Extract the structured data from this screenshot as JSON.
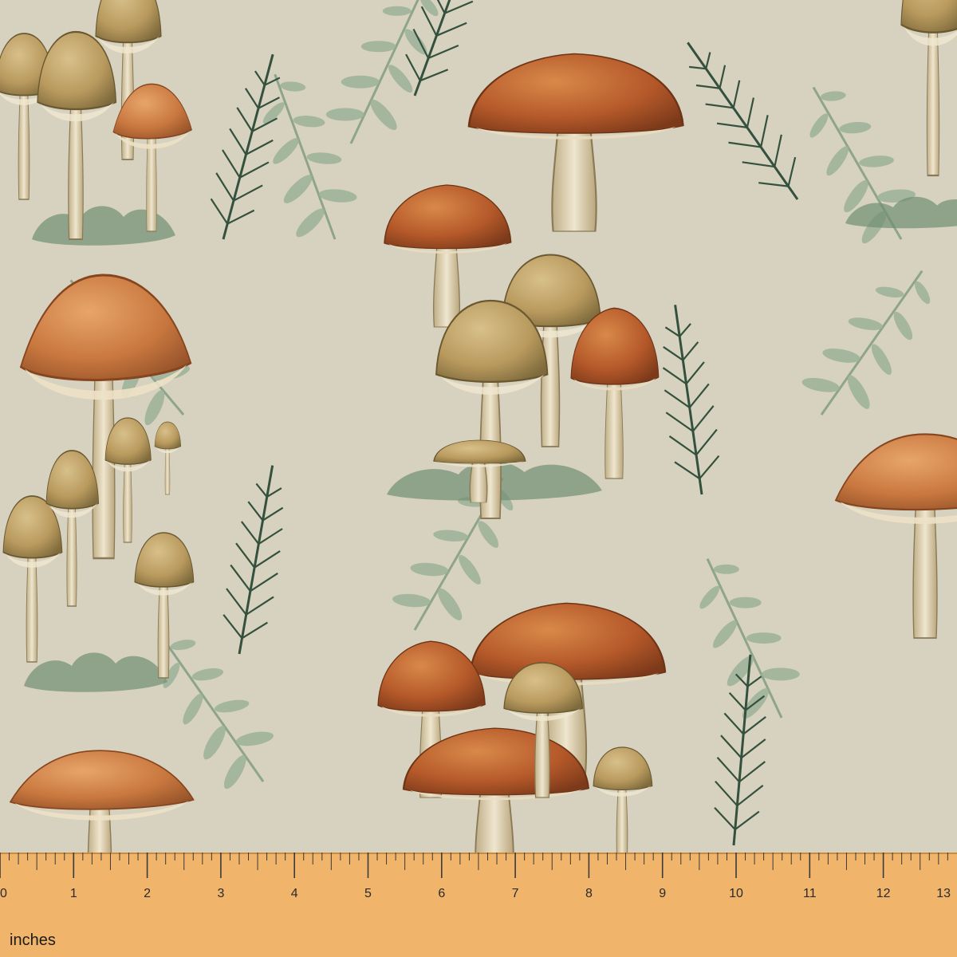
{
  "fabric": {
    "background_color": "#d6d2bf",
    "motifs": [
      "mushroom-cluster-icon",
      "fern-leaf-icon",
      "pine-sprig-icon"
    ],
    "colors": {
      "cap_rust": "#b5592a",
      "cap_orange": "#c9783f",
      "cap_tan": "#b99a5e",
      "stem": "#e6dcc2",
      "leaf_sage": "#8ea48b",
      "leaf_dark": "#34513e"
    }
  },
  "ruler": {
    "unit_label": "inches",
    "color": "#f0b56a",
    "tick_labels": [
      "0",
      "1",
      "2",
      "3",
      "4",
      "5",
      "6",
      "7",
      "8",
      "9",
      "10",
      "11",
      "12",
      "13"
    ]
  }
}
